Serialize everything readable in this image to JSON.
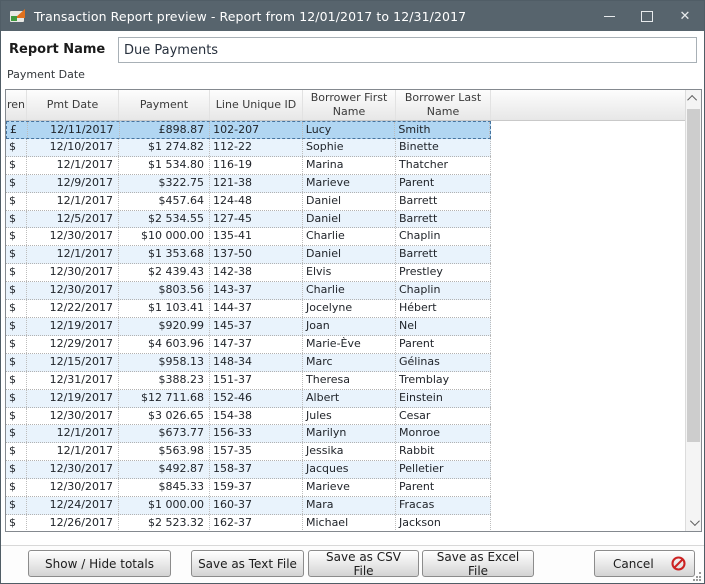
{
  "titlebar": {
    "title": "Transaction Report preview - Report from 12/01/2017 to 12/31/2017"
  },
  "form": {
    "report_name_label": "Report Name",
    "report_name_value": "Due Payments",
    "filter_label": "Payment Date"
  },
  "table": {
    "columns": [
      {
        "key": "cur",
        "label": "ren"
      },
      {
        "key": "date",
        "label": "Pmt Date"
      },
      {
        "key": "payment",
        "label": "Payment"
      },
      {
        "key": "line_id",
        "label": "Line Unique ID"
      },
      {
        "key": "first_name",
        "label": "Borrower First Name"
      },
      {
        "key": "last_name",
        "label": "Borrower Last Name"
      }
    ],
    "rows": [
      {
        "cur": "£",
        "date": "12/11/2017",
        "payment": "£898.87",
        "line_id": "102-207",
        "first_name": "Lucy",
        "last_name": "Smith",
        "selected": true
      },
      {
        "cur": "$",
        "date": "12/10/2017",
        "payment": "$1 274.82",
        "line_id": "112-22",
        "first_name": "Sophie",
        "last_name": "Binette"
      },
      {
        "cur": "$",
        "date": "12/1/2017",
        "payment": "$1 534.80",
        "line_id": "116-19",
        "first_name": "Marina",
        "last_name": "Thatcher"
      },
      {
        "cur": "$",
        "date": "12/9/2017",
        "payment": "$322.75",
        "line_id": "121-38",
        "first_name": "Marieve",
        "last_name": "Parent"
      },
      {
        "cur": "$",
        "date": "12/1/2017",
        "payment": "$457.64",
        "line_id": "124-48",
        "first_name": "Daniel",
        "last_name": "Barrett"
      },
      {
        "cur": "$",
        "date": "12/5/2017",
        "payment": "$2 534.55",
        "line_id": "127-45",
        "first_name": "Daniel",
        "last_name": "Barrett"
      },
      {
        "cur": "$",
        "date": "12/30/2017",
        "payment": "$10 000.00",
        "line_id": "135-41",
        "first_name": "Charlie",
        "last_name": "Chaplin"
      },
      {
        "cur": "$",
        "date": "12/1/2017",
        "payment": "$1 353.68",
        "line_id": "137-50",
        "first_name": "Daniel",
        "last_name": "Barrett"
      },
      {
        "cur": "$",
        "date": "12/30/2017",
        "payment": "$2 439.43",
        "line_id": "142-38",
        "first_name": "Elvis",
        "last_name": "Prestley"
      },
      {
        "cur": "$",
        "date": "12/30/2017",
        "payment": "$803.56",
        "line_id": "143-37",
        "first_name": "Charlie",
        "last_name": "Chaplin"
      },
      {
        "cur": "$",
        "date": "12/22/2017",
        "payment": "$1 103.41",
        "line_id": "144-37",
        "first_name": "Jocelyne",
        "last_name": "Hébert"
      },
      {
        "cur": "$",
        "date": "12/19/2017",
        "payment": "$920.99",
        "line_id": "145-37",
        "first_name": "Joan",
        "last_name": "Nel"
      },
      {
        "cur": "$",
        "date": "12/29/2017",
        "payment": "$4 603.96",
        "line_id": "147-37",
        "first_name": "Marie-Ève",
        "last_name": "Parent"
      },
      {
        "cur": "$",
        "date": "12/15/2017",
        "payment": "$958.13",
        "line_id": "148-34",
        "first_name": "Marc",
        "last_name": "Gélinas"
      },
      {
        "cur": "$",
        "date": "12/31/2017",
        "payment": "$388.23",
        "line_id": "151-37",
        "first_name": "Theresa",
        "last_name": "Tremblay"
      },
      {
        "cur": "$",
        "date": "12/19/2017",
        "payment": "$12 711.68",
        "line_id": "152-46",
        "first_name": "Albert",
        "last_name": "Einstein"
      },
      {
        "cur": "$",
        "date": "12/30/2017",
        "payment": "$3 026.65",
        "line_id": "154-38",
        "first_name": "Jules",
        "last_name": "Cesar"
      },
      {
        "cur": "$",
        "date": "12/1/2017",
        "payment": "$673.77",
        "line_id": "156-33",
        "first_name": "Marilyn",
        "last_name": "Monroe"
      },
      {
        "cur": "$",
        "date": "12/1/2017",
        "payment": "$563.98",
        "line_id": "157-35",
        "first_name": "Jessika",
        "last_name": "Rabbit"
      },
      {
        "cur": "$",
        "date": "12/30/2017",
        "payment": "$492.87",
        "line_id": "158-37",
        "first_name": "Jacques",
        "last_name": "Pelletier"
      },
      {
        "cur": "$",
        "date": "12/30/2017",
        "payment": "$845.33",
        "line_id": "159-37",
        "first_name": "Marieve",
        "last_name": "Parent"
      },
      {
        "cur": "$",
        "date": "12/24/2017",
        "payment": "$1 000.00",
        "line_id": "160-37",
        "first_name": "Mara",
        "last_name": "Fracas"
      },
      {
        "cur": "$",
        "date": "12/26/2017",
        "payment": "$2 523.32",
        "line_id": "162-37",
        "first_name": "Michael",
        "last_name": "Jackson"
      }
    ]
  },
  "buttons": {
    "show_hide_totals": "Show / Hide totals",
    "save_text": "Save as Text File",
    "save_csv": "Save as CSV File",
    "save_excel": "Save as Excel File",
    "cancel": "Cancel"
  },
  "colors": {
    "titlebar": "#57646d",
    "selected_row": "#b1d6f2",
    "alt_row": "#e9f3fc",
    "cancel_icon": "#cc2222"
  }
}
